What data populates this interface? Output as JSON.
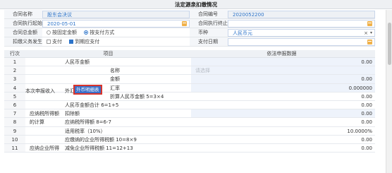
{
  "window": {
    "title": "法定源泉扣缴情况"
  },
  "form": {
    "contract_name_label": "合同名称",
    "contract_name_value": "股东会决议",
    "contract_no_label": "合同编号",
    "contract_no_value": "2020052200",
    "start_date_label": "合同执行起始时间",
    "start_date_value": "2020-05-01",
    "end_date_label": "合同执行终止时间",
    "end_date_value": "",
    "amount_label": "合同总金额",
    "amount_options": [
      "按固定金额",
      "按支付方式"
    ],
    "amount_selected": 1,
    "currency_label": "币种",
    "currency_value": "人民币元",
    "obligation_label": "扣缴义务发生时间",
    "obligation_options": [
      "支付",
      "到期应支付"
    ],
    "obligation_checked": 1,
    "pay_date_label": "支付日期",
    "pay_date_value": ""
  },
  "grid": {
    "headers": {
      "row": "行次",
      "item": "项目",
      "value": "依法申报数据"
    },
    "rows": [
      {
        "no": "1",
        "item": "人民币金额",
        "value": "0.00",
        "edit": true
      },
      {
        "no": "2",
        "item": "名称",
        "value": "",
        "placeholder": "请选择",
        "edit": true
      },
      {
        "no": "3",
        "item": "金额",
        "value": "0.00",
        "edit": true
      },
      {
        "no": "4",
        "item": "汇率",
        "value": "0.000000",
        "edit": true
      },
      {
        "no": "5",
        "item": "折算人民币金额 5=3×4",
        "value": "0.00",
        "edit": false
      },
      {
        "no": "6",
        "item": "人民币金额合计 6=1+5",
        "value": "0.00",
        "edit": false
      },
      {
        "no": "7",
        "item": "扣除额",
        "value": "0.00",
        "edit": true
      },
      {
        "no": "8",
        "item": "应纳税所得额 8=6-7",
        "value": "0.00",
        "edit": false
      },
      {
        "no": "9",
        "item": "适用税率（10%）",
        "value": "10.0000%",
        "edit": false
      },
      {
        "no": "10",
        "item": "应缴纳的企业所得税额 10=8×9",
        "value": "0.00",
        "edit": false
      },
      {
        "no": "11",
        "item": "减免企业所得税额 11=12+13",
        "value": "0.00",
        "edit": false
      }
    ],
    "group_label": "本次申报收入",
    "foreign_label": "外汇",
    "foreign_button": "外币明细表",
    "tax_base_label_a": "应纳税所得额",
    "tax_base_label_b": "的计算",
    "tax_calc_label": "应纳企业所得"
  },
  "colors": {
    "accent": "#2c73c9",
    "highlight_border": "#d9342b",
    "date_icon": "#f0b14a"
  }
}
